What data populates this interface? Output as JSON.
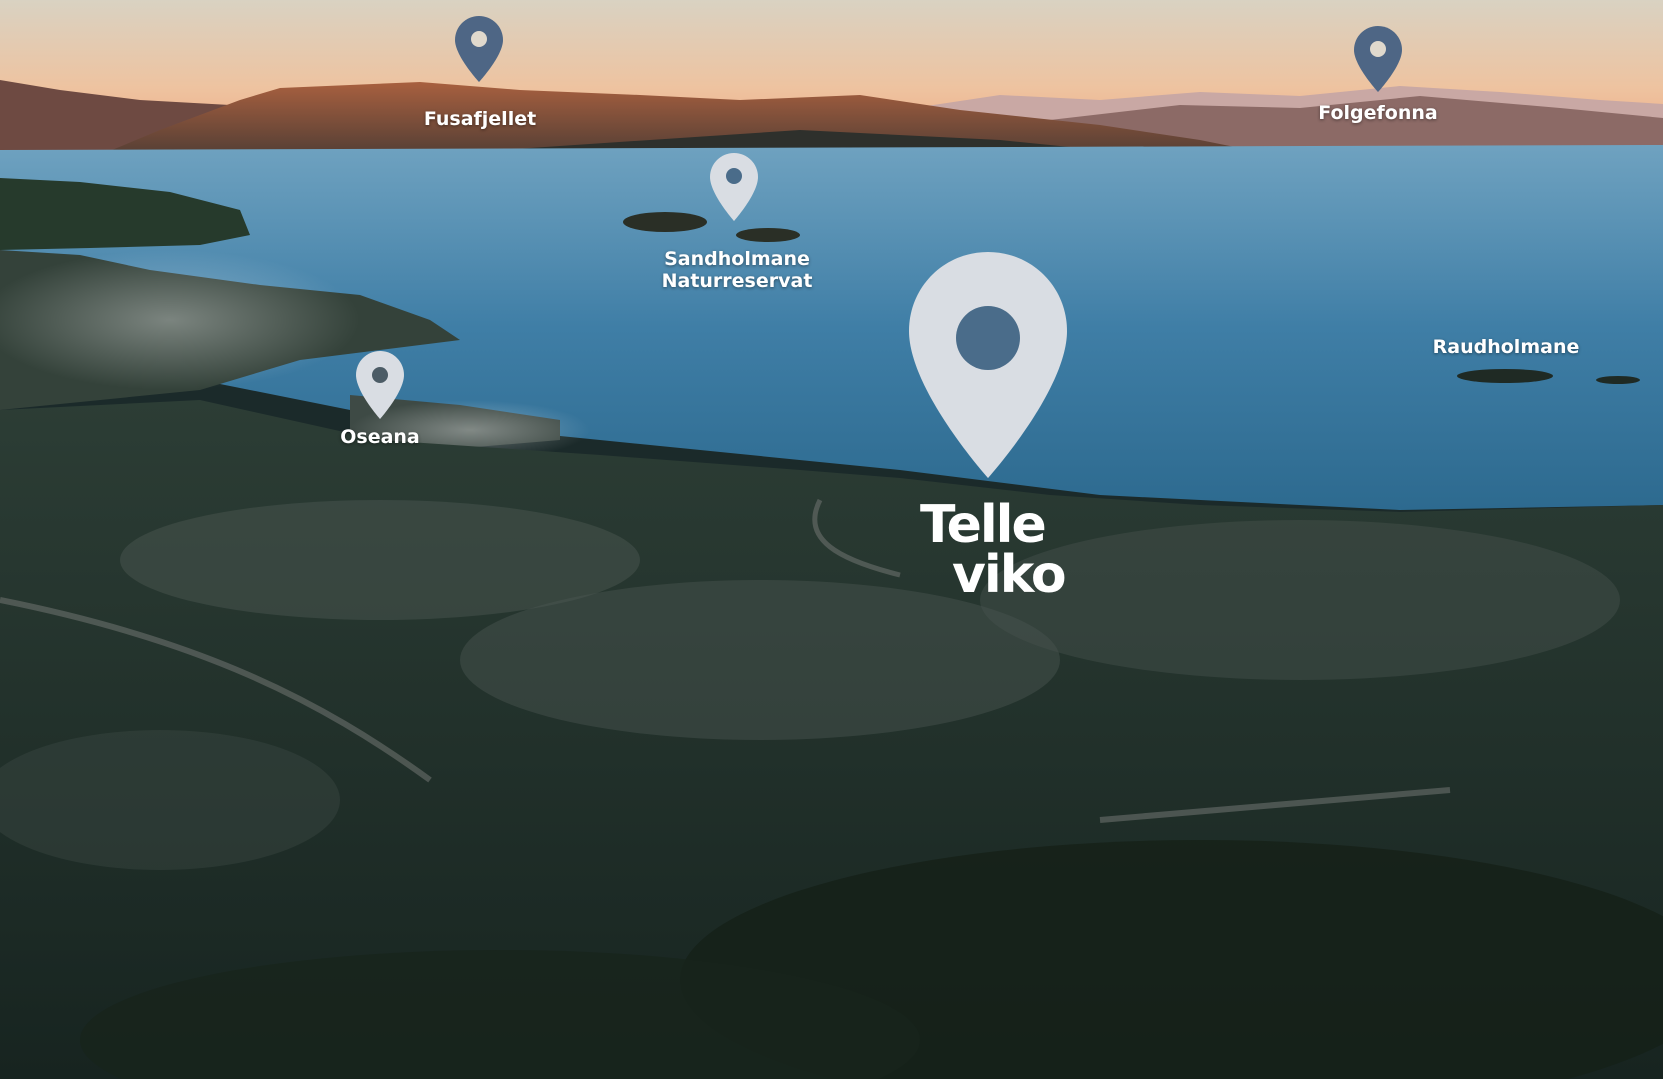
{
  "colors": {
    "pin_dark": "#4e6685",
    "pin_light": "#d9dde3",
    "sky_top": "#e8dcc6",
    "sky_glow": "#f2a77a",
    "water": "#3f7ea6",
    "land": "#1f2f2a"
  },
  "markers": [
    {
      "label": "Fusafjellet",
      "icon": "map-pin-icon",
      "style": "dark"
    },
    {
      "label": "Folgefonna",
      "icon": "map-pin-icon",
      "style": "dark"
    },
    {
      "label": "Sandholmane\nNaturreservat",
      "icon": "map-pin-icon",
      "style": "light"
    },
    {
      "label": "Oseana",
      "icon": "map-pin-icon",
      "style": "light"
    },
    {
      "label": "Raudholmane",
      "icon": "",
      "style": "none"
    }
  ],
  "logo": {
    "line1": "Telle",
    "line2": "viko",
    "icon": "map-pin-icon"
  }
}
